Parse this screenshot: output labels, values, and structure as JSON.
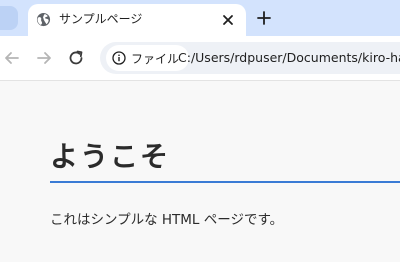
{
  "browser": {
    "tab": {
      "title": "サンプルページ",
      "favicon": "globe-icon",
      "close_icon": "close-icon"
    },
    "new_tab_icon": "plus-icon",
    "toolbar": {
      "back_icon": "back-arrow-icon",
      "forward_icon": "forward-arrow-icon",
      "reload_icon": "reload-icon",
      "site_info": {
        "icon": "info-icon",
        "label": "ファイル"
      },
      "url": "C:/Users/rdpuser/Documents/kiro-han"
    }
  },
  "page": {
    "heading": "ようこそ",
    "paragraph": "これはシンプルな HTML ページです。"
  },
  "colors": {
    "tabstrip_bg": "#d3e3fd",
    "heading_rule": "#3a7bd5",
    "page_bg": "#f8f8f8"
  }
}
